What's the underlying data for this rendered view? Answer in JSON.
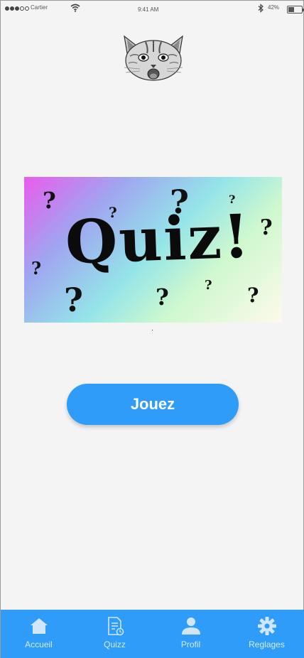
{
  "status_bar": {
    "carrier": "Cartier",
    "time": "9:41 AM",
    "battery": "42%",
    "battery_level": 0.42
  },
  "banner": {
    "word": "Quiz!",
    "mark": "?"
  },
  "play_button": {
    "label": "Jouez"
  },
  "tab_bar": {
    "items": [
      {
        "label": "Accueil",
        "icon": "home-icon"
      },
      {
        "label": "Quizz",
        "icon": "quiz-document-icon"
      },
      {
        "label": "Profil",
        "icon": "profile-icon"
      },
      {
        "label": "Reglages",
        "icon": "settings-icon"
      }
    ]
  },
  "colors": {
    "accent": "#2e9cf8",
    "tab_label": "#d5ebfe",
    "background": "#f4f4f4"
  }
}
